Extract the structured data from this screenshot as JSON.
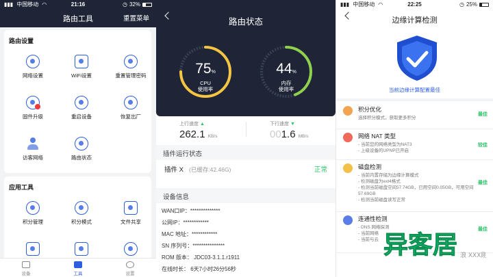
{
  "panel1": {
    "status": {
      "carrier": "中国移动",
      "time": "21:16",
      "battery": "32%",
      "battery_level": 0.32
    },
    "title": "路由工具",
    "reset_menu": "重置菜单",
    "router_settings": {
      "heading": "路由设置",
      "items": [
        {
          "label": "网络设置",
          "icon": "globe-icon"
        },
        {
          "label": "WiFi设置",
          "icon": "wifi-icon"
        },
        {
          "label": "重置管理密码",
          "icon": "lock-icon"
        },
        {
          "label": "固件升级",
          "icon": "upgrade-icon"
        },
        {
          "label": "重启设备",
          "icon": "restart-icon"
        },
        {
          "label": "恢复出厂",
          "icon": "factory-reset-icon"
        },
        {
          "label": "访客网络",
          "icon": "guest-icon"
        },
        {
          "label": "路由状态",
          "icon": "router-status-icon"
        }
      ]
    },
    "app_tools": {
      "heading": "应用工具",
      "items": [
        {
          "label": "积分管理",
          "icon": "points-icon"
        },
        {
          "label": "积分模式",
          "icon": "points-mode-icon"
        },
        {
          "label": "文件共享",
          "icon": "folder-icon"
        }
      ]
    },
    "tabs": [
      {
        "label": "设备",
        "icon": "device-icon"
      },
      {
        "label": "工具",
        "icon": "toolbox-icon"
      },
      {
        "label": "设置",
        "icon": "gear-icon"
      }
    ]
  },
  "panel2": {
    "status": {
      "carrier": "中国移动",
      "time": "21:16",
      "battery": "32%"
    },
    "title": "路由状态",
    "cpu": {
      "value": "75",
      "unit": "%",
      "label1": "CPU",
      "label2": "使用率",
      "percent": 75
    },
    "mem": {
      "value": "44",
      "unit": "%",
      "label1": "内存",
      "label2": "使用率",
      "percent": 44
    },
    "upload": {
      "label": "上行速度",
      "value": "262.1",
      "unit": "KB/s"
    },
    "download": {
      "label": "下行速度",
      "prefix": "00",
      "value": "1.6",
      "unit": "MB/s"
    },
    "plugin_section": "插件运行状态",
    "plugin": {
      "name": "插件 X",
      "cache": "(已缓存:42.46G)",
      "state": "正常"
    },
    "device_section": "设备信息",
    "info": [
      "WAN口IP：**************",
      "公网IP：************",
      "MAC 地址：************",
      "SN 序列号：***************",
      "ROM 版本： JDC03-3.1.1.r1911",
      "在线时长： 6天7小时26分56秒"
    ]
  },
  "panel3": {
    "status": {
      "carrier": "中国移动",
      "time": "22:25",
      "battery": "25%",
      "battery_level": 0.25
    },
    "title": "边缘计算检测",
    "caption": "当前边缘计算配置最佳",
    "rows": [
      {
        "title": "积分优化",
        "lines": [
          "选择积分模式，获取更多积分"
        ],
        "status": "最佳",
        "color": "#f3a450"
      },
      {
        "title": "网络 NAT 类型",
        "lines": [
          "- 当前您的网络类型为NAT3",
          "- 上级设备的UPNP已开启"
        ],
        "status": "较佳",
        "color": "#ef6a5a"
      },
      {
        "title": "磁盘检测",
        "lines": [
          "- 当前内置存储为边缘计算模式",
          "- 检测磁盘为ext4格式",
          "- 检测当前磁盘空间57.74GB，已用空间0.05GB，可用空间57.69GB",
          "- 检测当前磁盘读写正常"
        ],
        "status": "最佳",
        "color": "#f3c04a"
      },
      {
        "title": "连通性检测",
        "lines": [
          "- DNS 网络探测",
          "- 当前网络",
          "- 当前与云"
        ],
        "status": "最佳",
        "color": "#5b7de8"
      }
    ]
  },
  "watermark": {
    "brand": "异客居",
    "small": "浪",
    "small2": "XXX刚"
  }
}
